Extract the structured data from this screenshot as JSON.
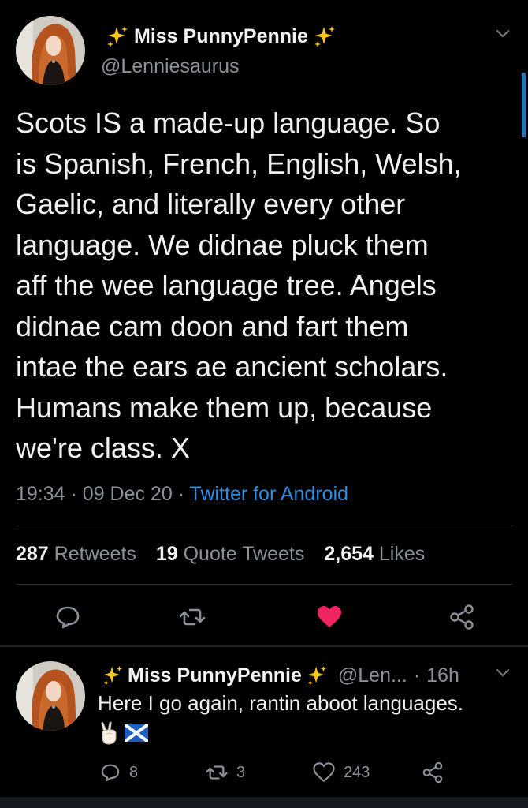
{
  "main_tweet": {
    "display_name": "Miss PunnyPennie",
    "handle": "@Lenniesaurus",
    "text_lines": [
      "Scots IS a made-up language. So",
      "is Spanish, French, English, Welsh,",
      "Gaelic, and literally every other",
      "language. We didnae pluck them",
      "aff the wee language tree. Angels",
      "didnae cam doon and fart them",
      "intae the ears ae ancient scholars.",
      "Humans make them up, because",
      "we're class. X"
    ],
    "time": "19:34",
    "separator": "·",
    "date": "09 Dec 20",
    "source": "Twitter for Android",
    "stats": {
      "retweets_count": "287",
      "retweets_label": "Retweets",
      "quotes_count": "19",
      "quotes_label": "Quote Tweets",
      "likes_count": "2,654",
      "likes_label": "Likes"
    },
    "actions": {
      "reply_icon": "speech-bubble-icon",
      "retweet_icon": "retweet-icon",
      "like_icon": "heart-filled-icon",
      "share_icon": "share-icon",
      "liked_color": "#f0245e"
    }
  },
  "reply_tweet": {
    "display_name": "Miss PunnyPennie",
    "handle": "@Len...",
    "separator": "·",
    "time_ago": "16h",
    "text": "Here I go again, rantin aboot languages.",
    "emoji_icons": [
      "victory-hand-icon",
      "scotland-flag-icon"
    ],
    "reply_count": "8",
    "retweet_count": "3",
    "like_count": "243"
  },
  "colors": {
    "background": "#000000",
    "text_primary": "#f0f0f0",
    "text_secondary": "#8a9199",
    "link": "#2f8ee0",
    "sparkle": "#f5c518",
    "divider": "#2c2f33"
  }
}
